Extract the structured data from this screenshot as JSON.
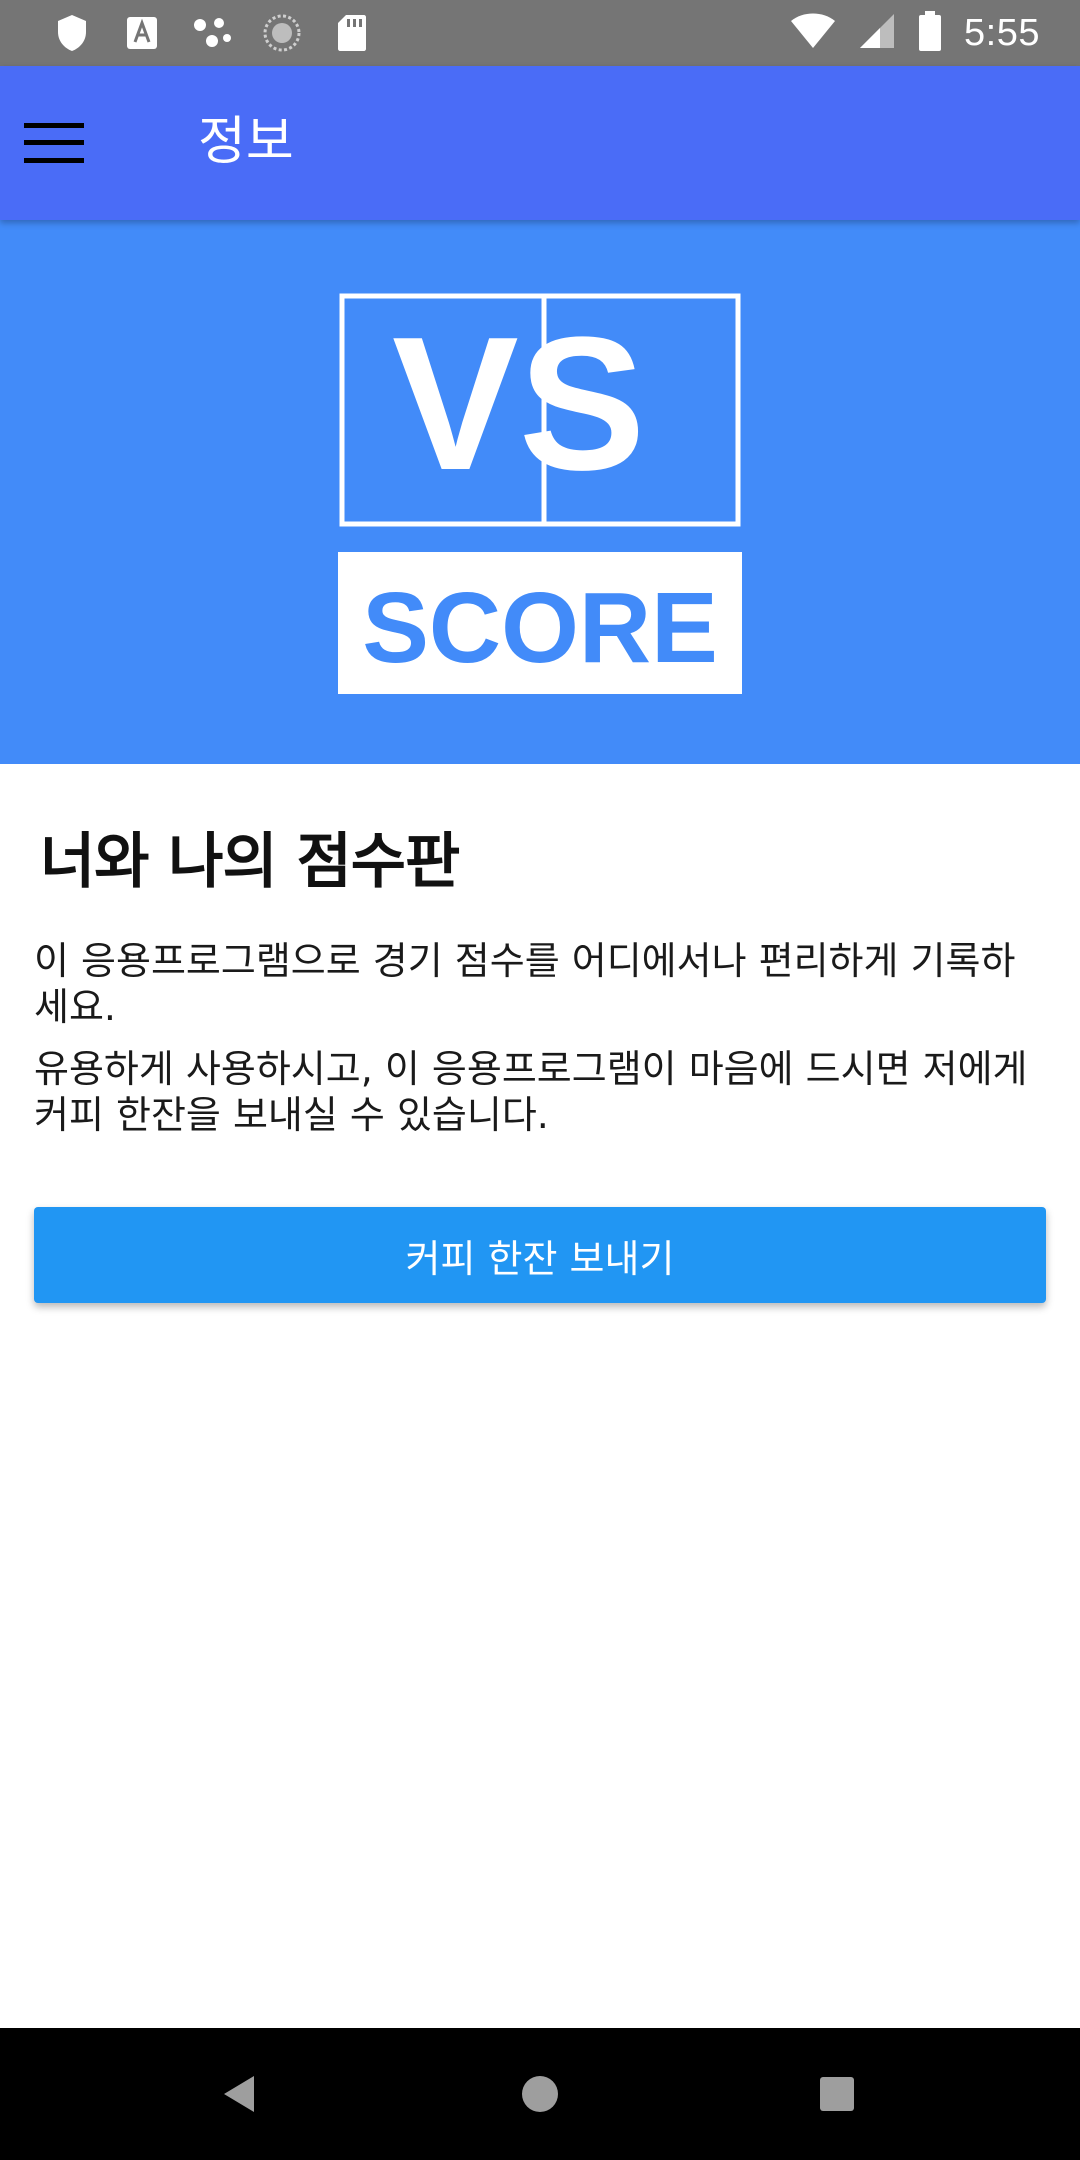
{
  "status_bar": {
    "time": "5:55",
    "left_icons": [
      "shield-icon",
      "text-a-icon",
      "dots-icon",
      "sync-circle-icon",
      "sd-card-icon"
    ],
    "right_icons": [
      "wifi-icon",
      "signal-icon",
      "battery-icon"
    ]
  },
  "app_bar": {
    "title": "정보",
    "menu_icon": "hamburger-menu-icon",
    "background": "#4A6CF7"
  },
  "hero": {
    "background": "#428BF9",
    "logo": {
      "top_text": "VS",
      "bottom_text": "SCORE"
    }
  },
  "content": {
    "title": "너와 나의 점수판",
    "paragraph_1": "이 응용프로그램으로 경기 점수를 어디에서나 편리하게 기록하세요.",
    "paragraph_2": "유용하게 사용하시고, 이 응용프로그램이 마음에 드시면 저에게 커피 한잔을 보내실 수 있습니다."
  },
  "actions": {
    "coffee_button_label": "커피 한잔 보내기",
    "button_color": "#2196F3"
  },
  "nav_bar": {
    "icons": [
      "back-icon",
      "home-icon",
      "recents-icon"
    ]
  }
}
